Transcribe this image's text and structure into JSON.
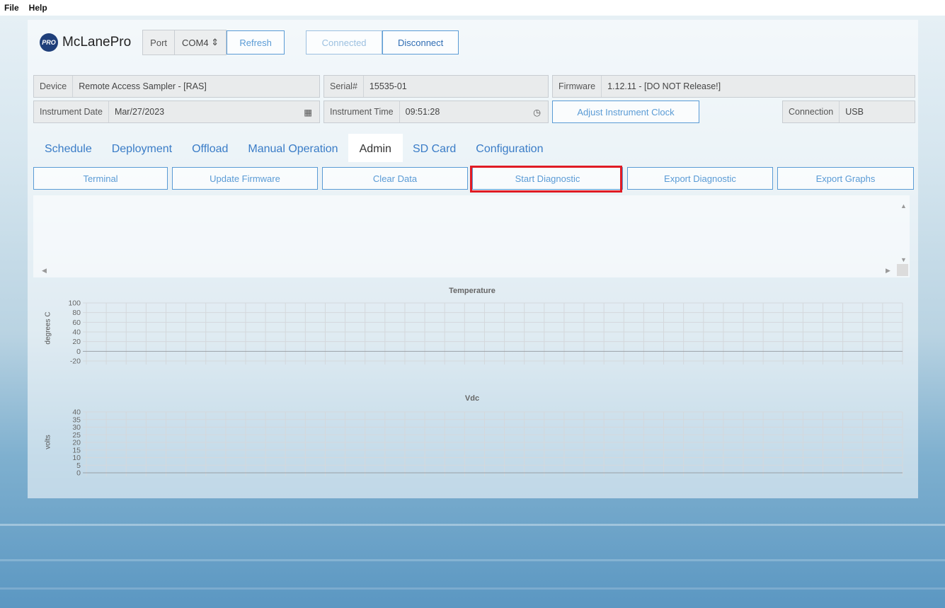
{
  "menu": [
    "File",
    "Help"
  ],
  "header": {
    "logo_text": "PRO",
    "brand": "McLanePro",
    "port_label": "Port",
    "port_value": "COM4",
    "refresh_label": "Refresh",
    "connected_label": "Connected",
    "disconnect_label": "Disconnect"
  },
  "info": {
    "device_label": "Device",
    "device_value": "Remote Access Sampler - [RAS]",
    "serial_label": "Serial#",
    "serial_value": "15535-01",
    "firmware_label": "Firmware",
    "firmware_value": "1.12.11 - [DO NOT Release!]",
    "date_label": "Instrument Date",
    "date_value": "Mar/27/2023",
    "time_label": "Instrument Time",
    "time_value": "09:51:28",
    "adjust_clock_label": "Adjust Instrument Clock",
    "connection_label": "Connection",
    "connection_value": "USB"
  },
  "tabs": [
    "Schedule",
    "Deployment",
    "Offload",
    "Manual Operation",
    "Admin",
    "SD Card",
    "Configuration"
  ],
  "active_tab": "Admin",
  "actions": [
    "Terminal",
    "Update Firmware",
    "Clear Data",
    "Start Diagnostic",
    "Export Diagnostic",
    "Export Graphs"
  ],
  "highlighted_action": "Start Diagnostic",
  "colors": {
    "accent": "#5a9bd5",
    "highlight": "#e01b24",
    "logo": "#1f3f7a"
  },
  "chart_data": [
    {
      "type": "line",
      "title": "Temperature",
      "ylabel": "degrees C",
      "ylim": [
        -20,
        100
      ],
      "yticks": [
        100,
        80,
        60,
        40,
        20,
        0,
        -20
      ],
      "series": [],
      "grid": true
    },
    {
      "type": "line",
      "title": "Vdc",
      "ylabel": "volts",
      "ylim": [
        0,
        40
      ],
      "yticks": [
        40,
        35,
        30,
        25,
        20,
        15,
        10,
        5,
        0
      ],
      "series": [],
      "grid": true
    }
  ]
}
